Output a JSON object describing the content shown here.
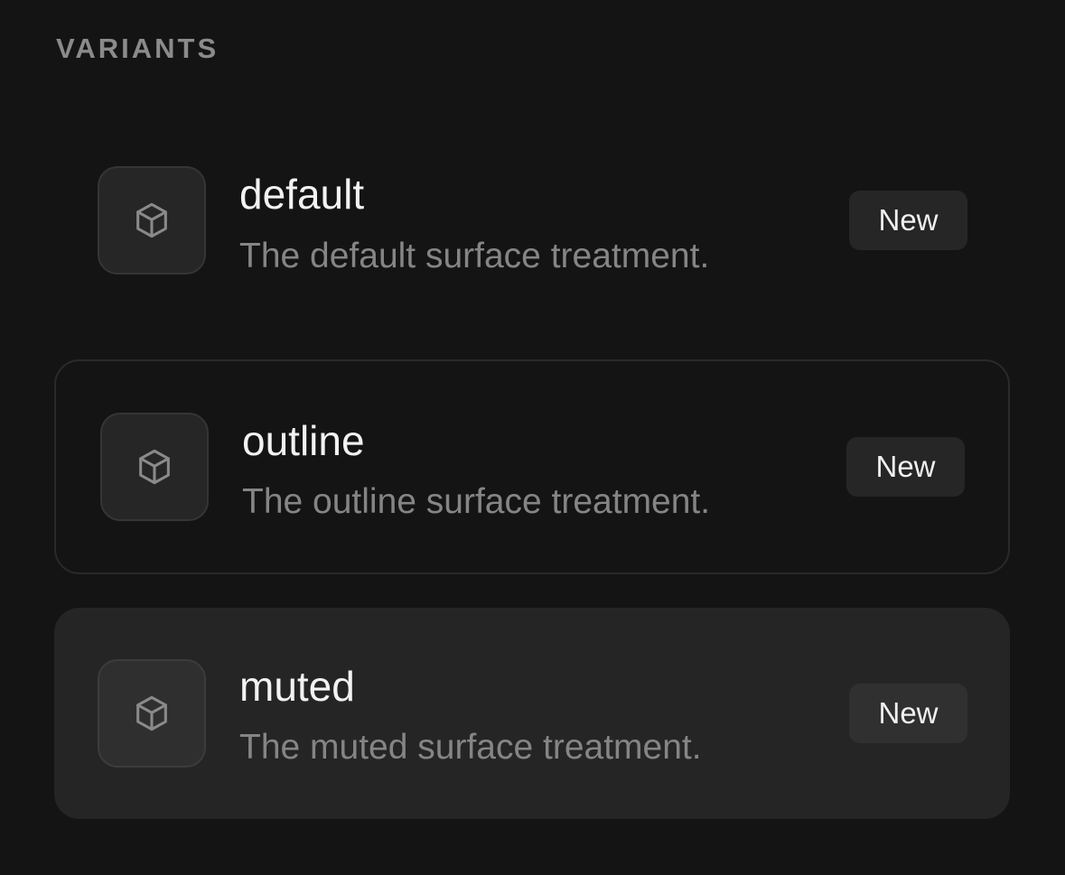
{
  "section": {
    "title": "VARIANTS"
  },
  "variants": [
    {
      "title": "default",
      "description": "The default surface treatment.",
      "badge": "New",
      "icon": "box-icon"
    },
    {
      "title": "outline",
      "description": "The outline surface treatment.",
      "badge": "New",
      "icon": "box-icon"
    },
    {
      "title": "muted",
      "description": "The muted surface treatment.",
      "badge": "New",
      "icon": "box-icon"
    }
  ],
  "colors": {
    "background": "#141414",
    "section_title": "#8b8b8b",
    "title": "#f2f2f2",
    "description": "#858585",
    "badge_bg": "#262626",
    "muted_surface": "#252525",
    "outline_border": "#2a2a2a"
  }
}
